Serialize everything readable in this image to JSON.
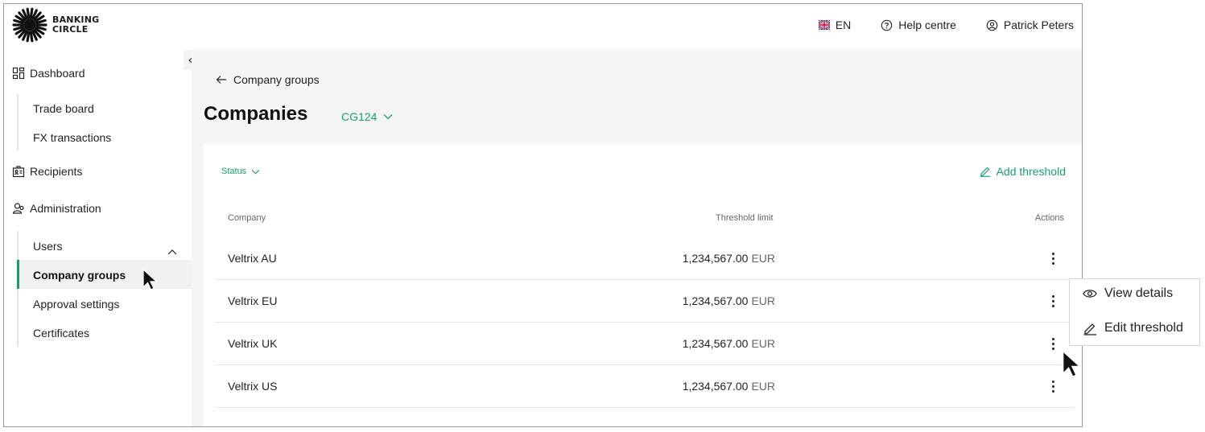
{
  "brand": {
    "line1": "BANKING",
    "line2": "CIRCLE",
    "accent": "#1f9a6d"
  },
  "header": {
    "language": "EN",
    "help": "Help centre",
    "user": "Patrick Peters"
  },
  "sidebar": {
    "dashboard": {
      "label": "Dashboard",
      "items": [
        {
          "label": "Trade board"
        },
        {
          "label": "FX transactions"
        }
      ]
    },
    "recipients": {
      "label": "Recipients"
    },
    "administration": {
      "label": "Administration",
      "items": [
        {
          "label": "Users"
        },
        {
          "label": "Company groups",
          "active": true
        },
        {
          "label": "Approval settings"
        },
        {
          "label": "Certificates"
        }
      ]
    }
  },
  "main": {
    "back_label": "Company groups",
    "title": "Companies",
    "group_selector": "CG124",
    "status_filter": "Status",
    "add_threshold": "Add threshold",
    "columns": {
      "company": "Company",
      "threshold": "Threshold limit",
      "actions": "Actions"
    },
    "rows": [
      {
        "company": "Veltrix AU",
        "amount": "1,234,567.00",
        "currency": "EUR"
      },
      {
        "company": "Veltrix EU",
        "amount": "1,234,567.00",
        "currency": "EUR"
      },
      {
        "company": "Veltrix UK",
        "amount": "1,234,567.00",
        "currency": "EUR"
      },
      {
        "company": "Veltrix US",
        "amount": "1,234,567.00",
        "currency": "EUR"
      }
    ]
  },
  "action_menu": {
    "view_details": "View details",
    "edit_threshold": "Edit threshold"
  }
}
